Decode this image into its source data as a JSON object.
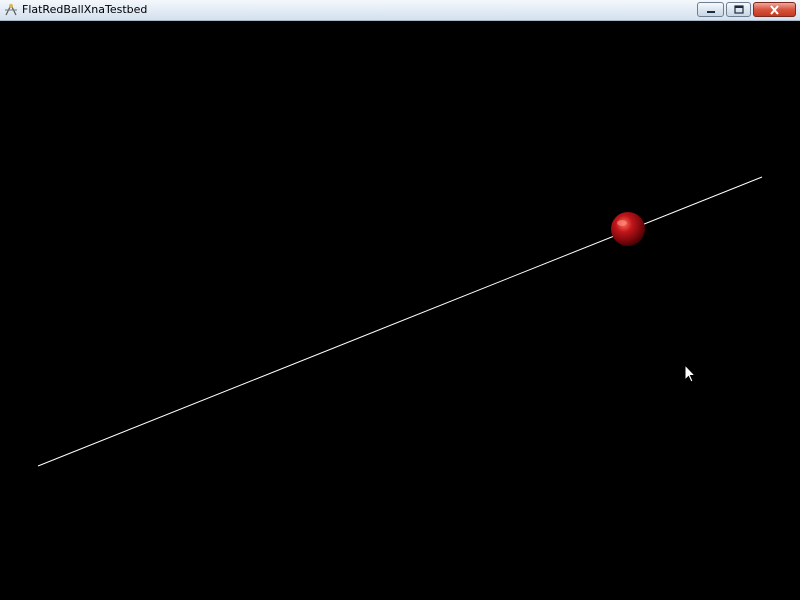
{
  "window": {
    "title": "FlatRedBallXnaTestbed",
    "icon": "app-icon",
    "controls": {
      "minimize_icon": "minimize-icon",
      "maximize_icon": "maximize-icon",
      "close_icon": "close-icon"
    }
  },
  "scene": {
    "background_color": "#000000",
    "line_color": "#ffffff",
    "ball_color": "#c0151a",
    "cursor_icon": "arrow-cursor-icon"
  }
}
